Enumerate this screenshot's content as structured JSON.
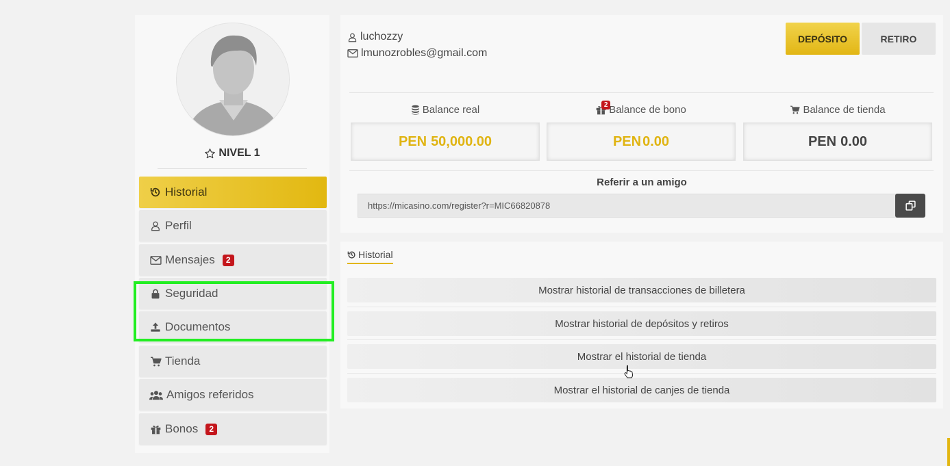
{
  "profile": {
    "level_label": "NIVEL 1"
  },
  "sidebar": {
    "items": [
      {
        "label": "Historial",
        "icon": "history-icon"
      },
      {
        "label": "Perfil",
        "icon": "user-icon"
      },
      {
        "label": "Mensajes",
        "icon": "envelope-icon",
        "badge": "2"
      },
      {
        "label": "Seguridad",
        "icon": "lock-icon"
      },
      {
        "label": "Documentos",
        "icon": "upload-icon"
      },
      {
        "label": "Tienda",
        "icon": "cart-icon"
      },
      {
        "label": "Amigos referidos",
        "icon": "users-icon"
      },
      {
        "label": "Bonos",
        "icon": "gift-icon",
        "badge": "2"
      }
    ]
  },
  "account": {
    "username": "luchozzy",
    "email": "lmunozrobles@gmail.com"
  },
  "actions": {
    "deposit_label": "DEPÓSITO",
    "withdraw_label": "RETIRO"
  },
  "balances": {
    "real": {
      "label": "Balance real",
      "currency": "PEN",
      "amount": "50,000.00"
    },
    "bonus": {
      "label": "Balance de bono",
      "currency": "PEN",
      "amount": "0.00",
      "badge": "2"
    },
    "store": {
      "label": "Balance de tienda",
      "currency": "PEN",
      "amount": "0.00"
    }
  },
  "referral": {
    "title": "Referir a un amigo",
    "link": "https://micasino.com/register?r=MIC66820878"
  },
  "history": {
    "tab_label": "Historial",
    "rows": [
      "Mostrar historial de transacciones de billetera",
      "Mostrar historial de depósitos y retiros",
      "Mostrar el historial de tienda",
      "Mostrar el historial de canjes de tienda"
    ]
  },
  "colors": {
    "accent_gold": "#e2b611",
    "badge_red": "#c4161c",
    "highlight_green": "#22ee22"
  }
}
